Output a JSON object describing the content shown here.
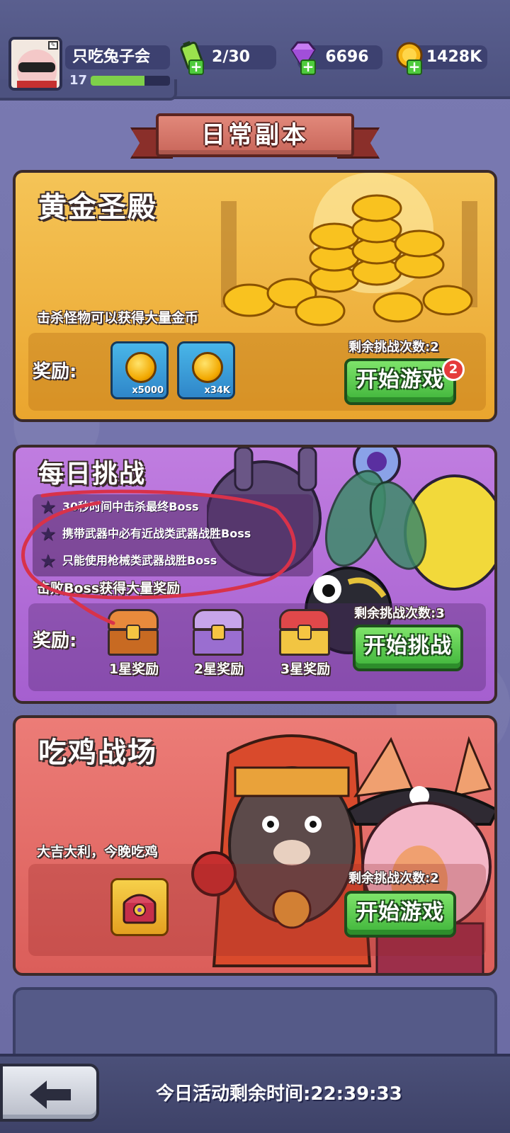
{
  "player": {
    "name": "只吃兔子会",
    "level": "17",
    "xp_fraction": 0.68
  },
  "resources": {
    "energy": "2/30",
    "gems": "6696",
    "gold": "1428K"
  },
  "page_title": "日常副本",
  "gold_temple": {
    "title": "黄金圣殿",
    "description": "击杀怪物可以获得大量金币",
    "reward_label": "奖励:",
    "rewards": [
      {
        "icon": "gold-coin-icon",
        "qty": "x5000"
      },
      {
        "icon": "gold-coin-icon",
        "qty": "x34K"
      }
    ],
    "remaining": "剩余挑战次数:2",
    "button": "开始游戏",
    "badge": "2"
  },
  "daily_challenge": {
    "title": "每日挑战",
    "objectives": [
      "30秒时间中击杀最终Boss",
      "携带武器中必有近战类武器战胜Boss",
      "只能使用枪械类武器战胜Boss"
    ],
    "description": "击败Boss获得大量奖励",
    "reward_label": "奖励:",
    "chests": [
      {
        "label": "1星奖励",
        "color": "#e88a3c"
      },
      {
        "label": "2星奖励",
        "color": "#b98be0"
      },
      {
        "label": "3星奖励",
        "color": "#d84545"
      }
    ],
    "remaining": "剩余挑战次数:3",
    "button": "开始挑战"
  },
  "battle_royale": {
    "title": "吃鸡战场",
    "description": "大吉大利，今晚吃鸡",
    "remaining": "剩余挑战次数:2",
    "button": "开始游戏"
  },
  "footer": {
    "timer": "今日活动剩余时间:22:39:33"
  },
  "colors": {
    "gold_card": "#f2b640",
    "purple_card": "#b26ad6",
    "red_card": "#e46a66",
    "button_green": "#4fc347",
    "annotation_red": "#d8324a"
  }
}
